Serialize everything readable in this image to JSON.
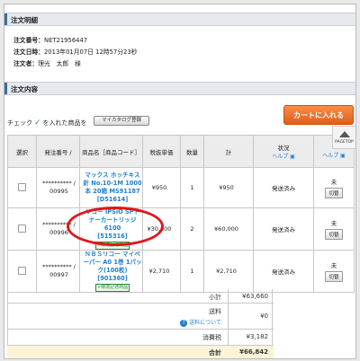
{
  "order_details": {
    "section_title": "注文明細",
    "order_number_label": "注文番号：",
    "order_number": "NET21956447",
    "order_datetime_label": "注文日時：",
    "order_datetime": "2013年01月07日 12時57分23秒",
    "orderer_label": "注文者：",
    "orderer": "理光　太郎　様"
  },
  "order_contents": {
    "section_title": "注文内容",
    "check_text_pre": "チェック",
    "check_text_post": "を入れた商品を",
    "mycatalog_button": "マイカタログ登録",
    "cart_button": "カートに入れる",
    "pagetop": "PAGETOP"
  },
  "table": {
    "headers": {
      "select": "選択",
      "order_no": "発注番号 /",
      "product": "商品名［商品コード］",
      "unit_price": "税抜単価",
      "qty": "数量",
      "total": "計",
      "status": "状況",
      "status_help": "ヘルプ",
      "ship_help": "ヘルプ"
    },
    "rows": [
      {
        "order_no": "********** /",
        "order_sub": "00995",
        "name": "マックス ホッチキス針 No.10-1M 1000本 20箱 MS91187",
        "code": "[D51614]",
        "badge": "",
        "unit_price": "¥950",
        "qty": "1",
        "total": "¥950",
        "status": "発送済み",
        "ship": "未",
        "ship_button": "切替"
      },
      {
        "order_no": "********** /",
        "order_sub": "00996",
        "name": "リコー IPSiO SPトナーカートリッジ6100",
        "code": "[515316]",
        "badge": "+環境記述商品",
        "unit_price": "¥30,000",
        "qty": "2",
        "total": "¥60,000",
        "status": "発送済み",
        "ship": "未",
        "ship_button": "切替"
      },
      {
        "order_no": "********** /",
        "order_sub": "00997",
        "name": "ＮＢＳリコー マイペーパー A0 1巻 1パック(100枚)",
        "code": "[901360]",
        "badge": "+環境記述商品",
        "unit_price": "¥2,710",
        "qty": "1",
        "total": "¥2,710",
        "status": "発送済み",
        "ship": "未",
        "ship_button": "切替"
      }
    ]
  },
  "summary": {
    "subtotal_label": "小計",
    "subtotal": "¥63,660",
    "shipping_label": "送料",
    "shipping": "¥0",
    "shipping_link": "送料について",
    "tax_label": "消費税",
    "tax": "¥3,182",
    "total_label": "合計",
    "total": "¥66,842"
  },
  "colors": {
    "accent": "#1d7fd1",
    "cart_button": "#e86a2a",
    "highlight_ellipse": "#e0161a",
    "total_background": "#fbf4d8"
  }
}
